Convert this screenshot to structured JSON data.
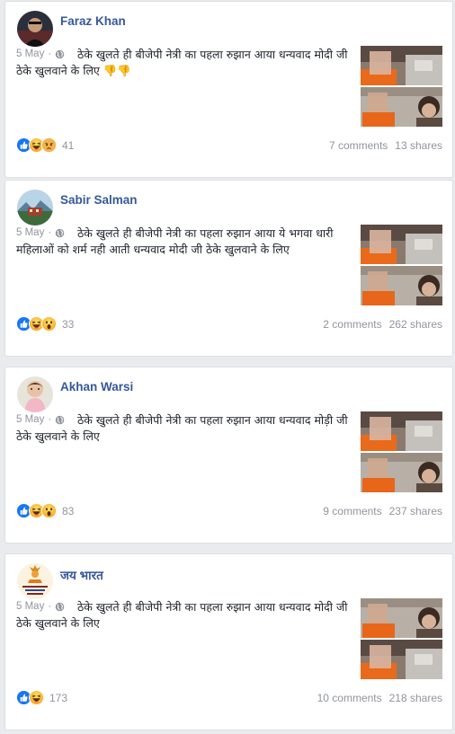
{
  "posts": [
    {
      "author": "Faraz Khan",
      "date": "5 May",
      "dot": "·",
      "text": "ठेके खुलते ही बीजेपी नेत्री का पहला रुझान आया धन्यवाद मोदी जी ठेके खुलवाने के लिए 👎👎",
      "reactions": [
        "like-icon",
        "haha-icon",
        "angry-icon"
      ],
      "reaction_count": "41",
      "comments": "7 comments",
      "shares": "13 shares"
    },
    {
      "author": "Sabir Salman",
      "date": "5 May",
      "dot": "·",
      "text": "ठेके खुलते ही बीजेपी नेत्री का पहला रुझान आया ये भगवा धारी महिलाओं को शर्म नही आती धन्यवाद मोदी जी ठेके खुलवाने के लिए",
      "reactions": [
        "like-icon",
        "haha-icon",
        "wow-icon"
      ],
      "reaction_count": "33",
      "comments": "2 comments",
      "shares": "262 shares"
    },
    {
      "author": "Akhan Warsi",
      "date": "5 May",
      "dot": "·",
      "text": "ठेके खुलते ही बीजेपी नेत्री का पहला रुझान आया धन्यवाद मोड़ी जी ठेके खुलवाने के लिए",
      "reactions": [
        "like-icon",
        "haha-icon",
        "wow-icon"
      ],
      "reaction_count": "83",
      "comments": "9 comments",
      "shares": "237 shares"
    },
    {
      "author": "जय भारत",
      "date": "5 May",
      "dot": "·",
      "text": "ठेके खुलते ही बीजेपी नेत्री का पहला रुझान आया धन्यवाद मोदी जी ठेके खुलवाने के लिए",
      "reactions": [
        "like-icon",
        "haha-icon"
      ],
      "reaction_count": "173",
      "comments": "10 comments",
      "shares": "218 shares"
    }
  ],
  "colors": {
    "background": "#e9ebee",
    "author": "#365899",
    "muted": "#90949c",
    "like_blue": "#1877f2",
    "emoji_yellow": "#f7b125"
  }
}
